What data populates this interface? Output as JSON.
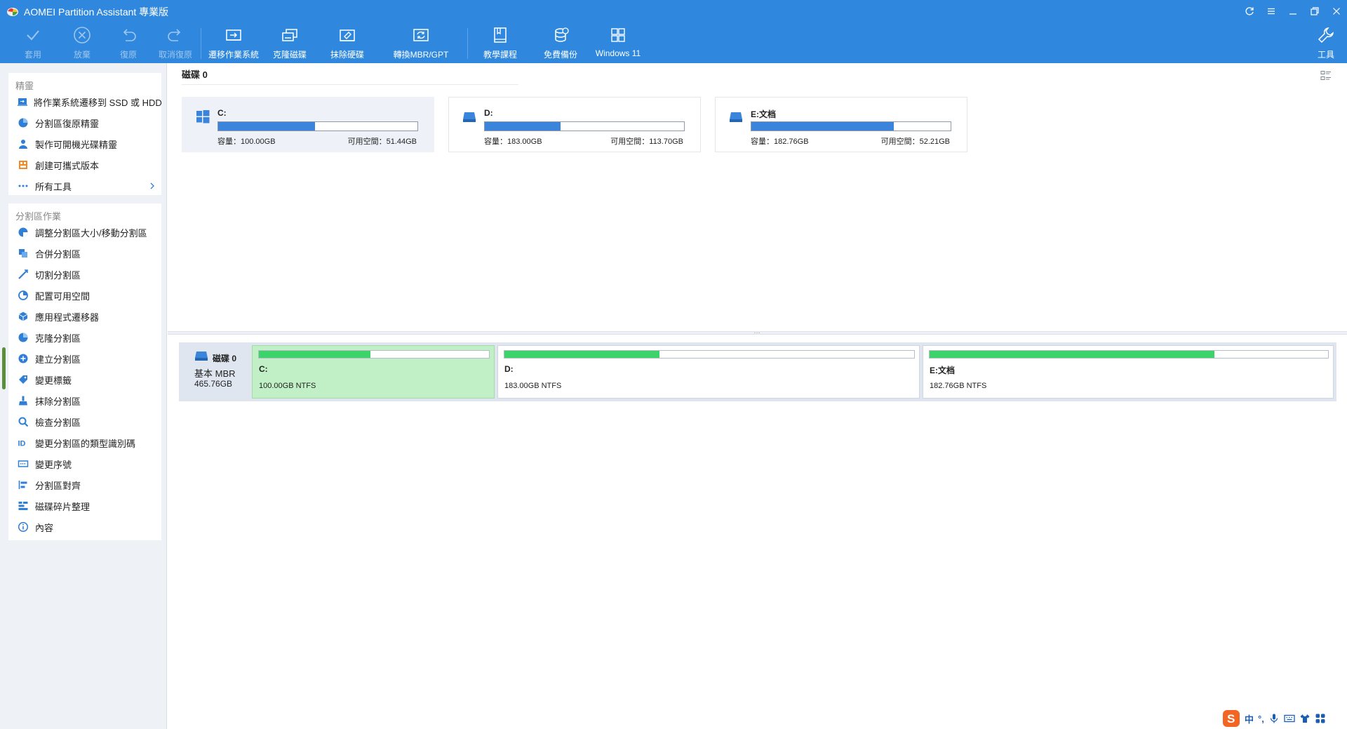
{
  "window": {
    "title": "AOMEI Partition Assistant 專業版",
    "controls": [
      "refresh-icon",
      "menu-icon",
      "minimize-icon",
      "restore-icon",
      "close-icon"
    ]
  },
  "toolbar": {
    "apply": "套用",
    "discard": "放棄",
    "undo": "復原",
    "redo": "取消復原",
    "migrate_os": "遷移作業系統",
    "clone_disk": "克隆磁碟",
    "wipe_disk": "抹除硬碟",
    "convert": "轉換MBR/GPT",
    "tutorial": "教學課程",
    "backup": "免費備份",
    "win11": "Windows 11",
    "tools": "工具"
  },
  "sidebar": {
    "wizards_title": "精靈",
    "wizards": [
      {
        "label": "將作業系統遷移到 SSD 或 HDD",
        "icon": "migrate-icon"
      },
      {
        "label": "分割區復原精靈",
        "icon": "recovery-icon"
      },
      {
        "label": "製作可開機光碟精靈",
        "icon": "bootable-media-icon"
      },
      {
        "label": "創建可攜式版本",
        "icon": "portable-icon"
      },
      {
        "label": "所有工具",
        "icon": "more-icon"
      }
    ],
    "ops_title": "分割區作業",
    "ops": [
      {
        "label": "調整分割區大小/移動分割區",
        "icon": "resize-icon"
      },
      {
        "label": "合併分割區",
        "icon": "merge-icon"
      },
      {
        "label": "切割分割區",
        "icon": "split-icon"
      },
      {
        "label": "配置可用空間",
        "icon": "allocate-icon"
      },
      {
        "label": "應用程式遷移器",
        "icon": "app-mover-icon"
      },
      {
        "label": "克隆分割區",
        "icon": "clone-partition-icon"
      },
      {
        "label": "建立分割區",
        "icon": "create-partition-icon"
      },
      {
        "label": "變更標籤",
        "icon": "label-icon"
      },
      {
        "label": "抹除分割區",
        "icon": "wipe-partition-icon"
      },
      {
        "label": "檢查分割區",
        "icon": "check-partition-icon"
      },
      {
        "label": "變更分割區的類型識別碼",
        "icon": "id-icon"
      },
      {
        "label": "變更序號",
        "icon": "serial-icon"
      },
      {
        "label": "分割區對齊",
        "icon": "align-icon"
      },
      {
        "label": "磁碟碎片整理",
        "icon": "defrag-icon"
      },
      {
        "label": "內容",
        "icon": "info-icon"
      }
    ]
  },
  "disk_view": {
    "title": "磁碟 0",
    "partitions": [
      {
        "name": "C:",
        "capacity": "容量：100.00GB",
        "free": "可用空間：51.44GB",
        "used_fraction": 0.486,
        "icon": "windows-icon",
        "selected": true
      },
      {
        "name": "D:",
        "capacity": "容量：183.00GB",
        "free": "可用空間：113.70GB",
        "used_fraction": 0.379,
        "icon": "drive-icon",
        "selected": false
      },
      {
        "name": "E:文档",
        "capacity": "容量：182.76GB",
        "free": "可用空間：52.21GB",
        "used_fraction": 0.714,
        "icon": "drive-icon",
        "selected": false
      }
    ]
  },
  "disk_map": {
    "disk_name": "磁碟 0",
    "disk_type": "基本 MBR",
    "disk_size": "465.76GB",
    "partitions": [
      {
        "label": "C:",
        "fs": "100.00GB NTFS",
        "used_fraction": 0.486,
        "selected": true
      },
      {
        "label": "D:",
        "fs": "183.00GB NTFS",
        "used_fraction": 0.379,
        "selected": false
      },
      {
        "label": "E:文档",
        "fs": "182.76GB NTFS",
        "used_fraction": 0.714,
        "selected": false
      }
    ]
  },
  "ime": {
    "lang": "中",
    "punct": "°,"
  },
  "colors": {
    "accent": "#2f88de",
    "bar_blue": "#3a84dc",
    "bar_green": "#3cd46a",
    "selected_green": "#c2f0c6"
  }
}
